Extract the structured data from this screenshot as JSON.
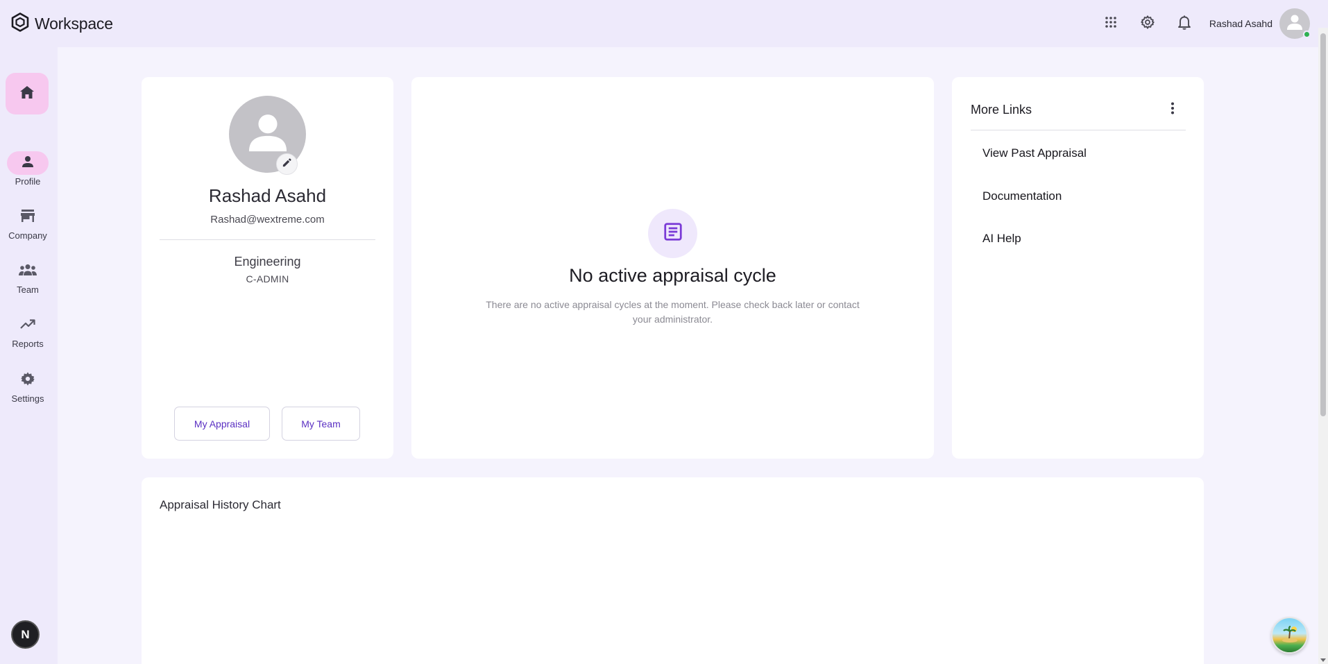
{
  "header": {
    "brand_title": "Workspace",
    "user_name": "Rashad Asahd",
    "icons": [
      "grid-icon",
      "gear-icon",
      "bell-icon",
      "avatar-icon"
    ]
  },
  "sidebar": {
    "items": [
      {
        "label": "Profile",
        "icon": "person-icon",
        "active": true
      },
      {
        "label": "Company",
        "icon": "store-icon",
        "active": false
      },
      {
        "label": "Team",
        "icon": "group-icon",
        "active": false
      },
      {
        "label": "Reports",
        "icon": "trending-up-icon",
        "active": false
      },
      {
        "label": "Settings",
        "icon": "gear-icon",
        "active": false
      }
    ],
    "bottom_badge": "N"
  },
  "profile": {
    "name": "Rashad Asahd",
    "email": "Rashad@wextreme.com",
    "department": "Engineering",
    "role": "C-ADMIN",
    "buttons": {
      "appraisal": "My Appraisal",
      "team": "My Team"
    }
  },
  "appraisal": {
    "title": "No active appraisal cycle",
    "description": "There are no active appraisal cycles at the moment. Please check back later or contact your administrator."
  },
  "links": {
    "title": "More Links",
    "items": [
      "View Past Appraisal",
      "Documentation",
      "AI Help"
    ]
  },
  "chart": {
    "title": "Appraisal History Chart"
  },
  "colors": {
    "accent": "#5a2fc2",
    "active_pill": "#f7c8ef",
    "background": "#f5f3fd",
    "topbar": "#eeeafb"
  }
}
